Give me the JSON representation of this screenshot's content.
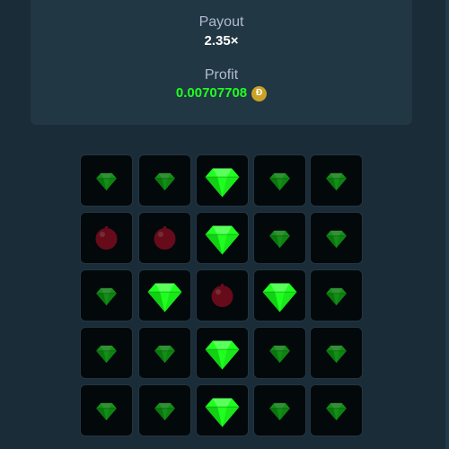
{
  "result": {
    "payout_label": "Payout",
    "payout_value": "2.35×",
    "profit_label": "Profit",
    "profit_value": "0.00707708",
    "currency_icon": "dogecoin-icon",
    "currency_symbol": "Ð"
  },
  "colors": {
    "gem": "#1fff20",
    "mine": "#e0102f",
    "tile_bg": "#03080b",
    "panel_bg": "#213743",
    "page_bg": "#1a2c38"
  },
  "board": {
    "rows": 5,
    "columns": 5,
    "tiles": [
      [
        "gem",
        "gem",
        "gem-revealed",
        "gem",
        "gem"
      ],
      [
        "mine",
        "mine",
        "gem-revealed",
        "gem",
        "gem"
      ],
      [
        "gem",
        "gem-revealed",
        "mine",
        "gem-revealed",
        "gem"
      ],
      [
        "gem",
        "gem",
        "gem-revealed",
        "gem",
        "gem"
      ],
      [
        "gem",
        "gem",
        "gem-revealed",
        "gem",
        "gem"
      ]
    ]
  }
}
